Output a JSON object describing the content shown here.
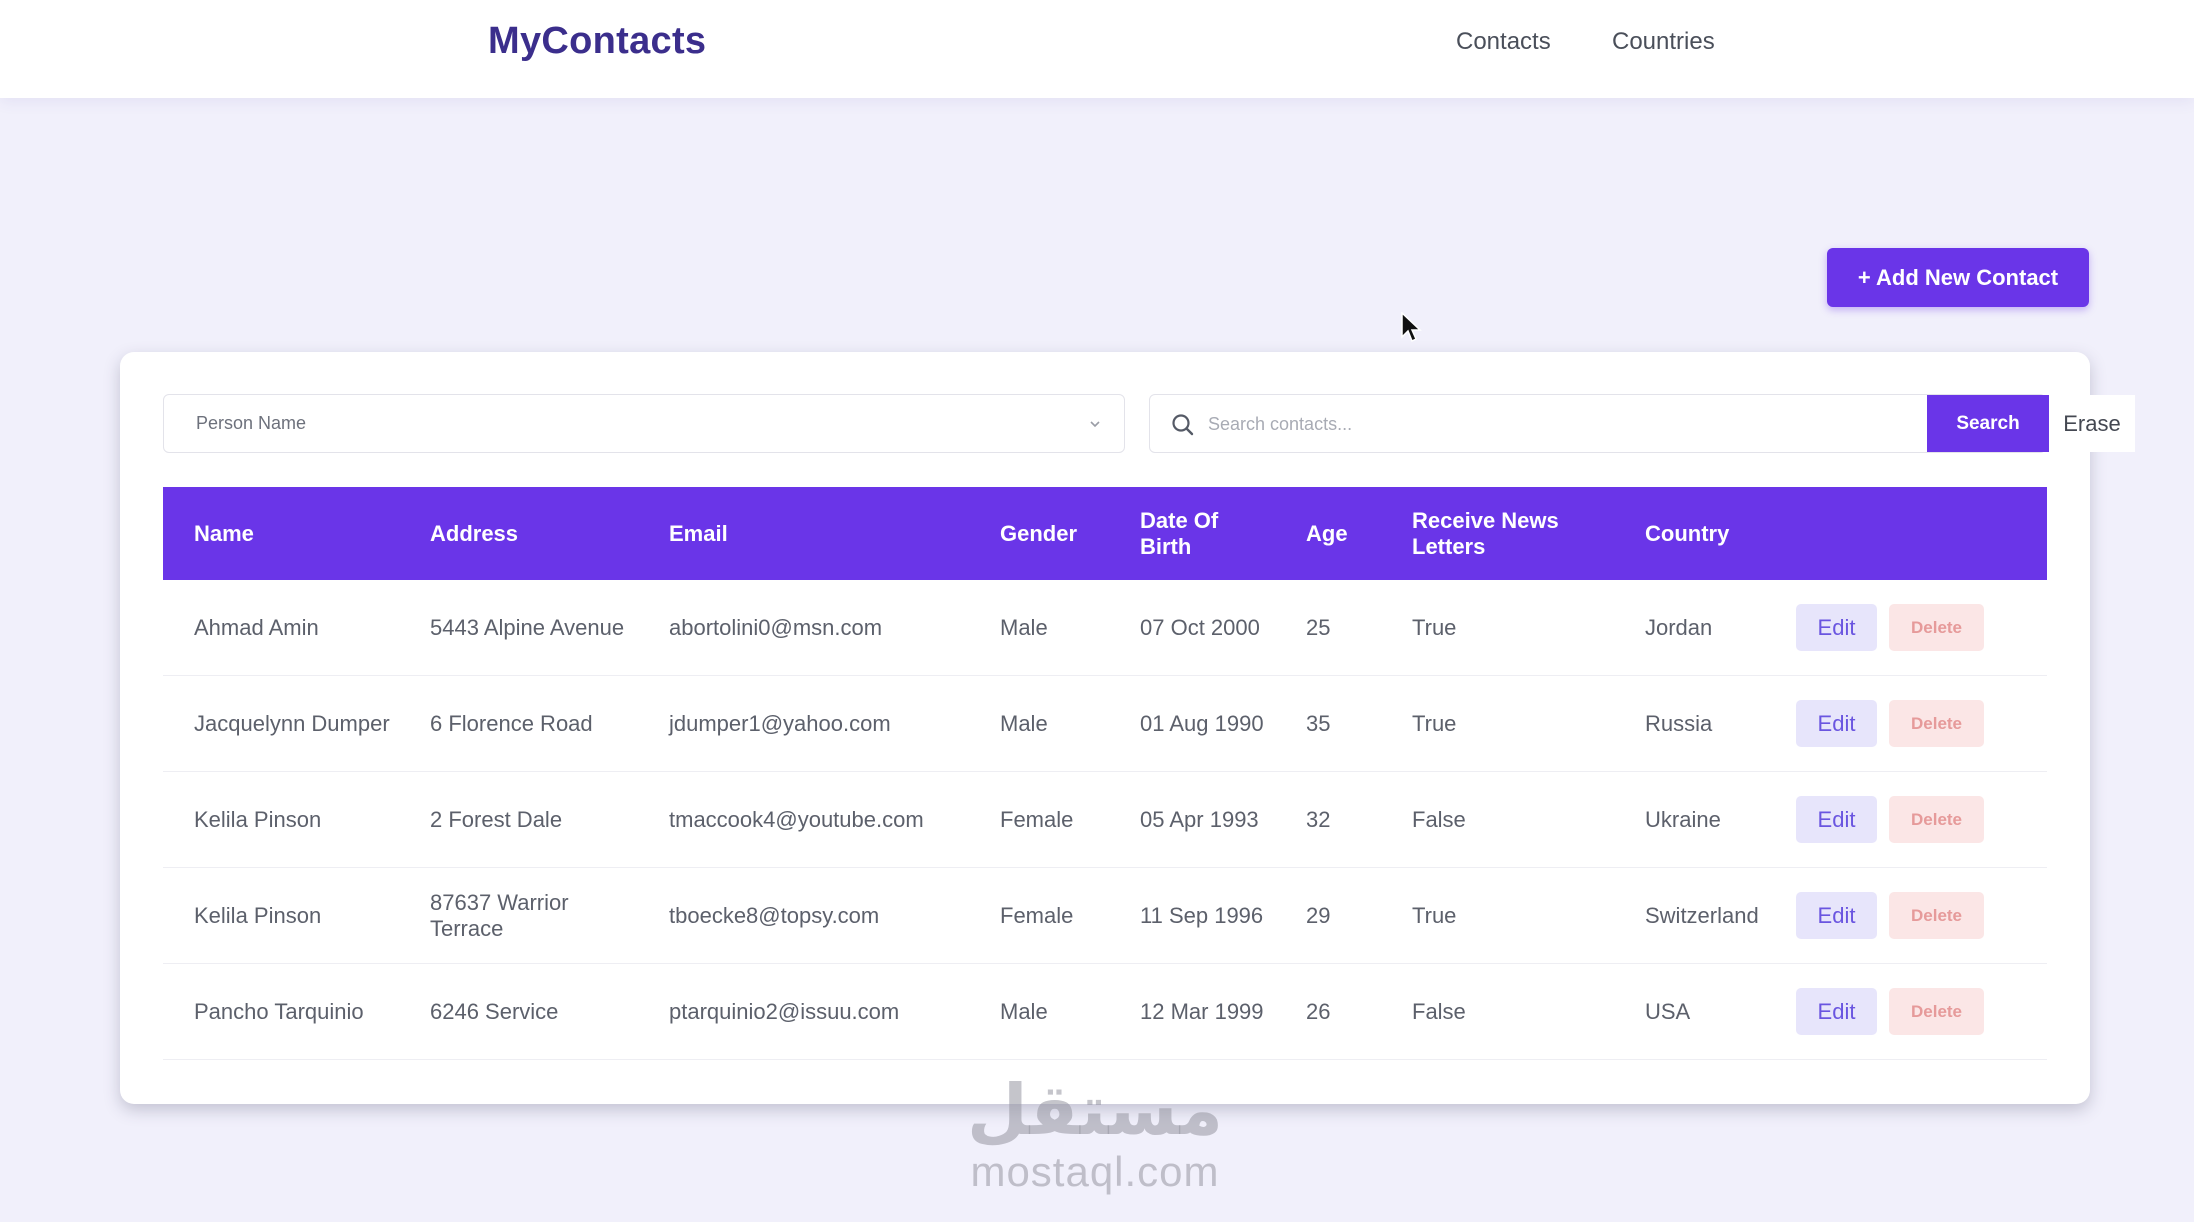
{
  "header": {
    "brand": "MyContacts",
    "nav": [
      {
        "label": "Contacts"
      },
      {
        "label": "Countries"
      }
    ]
  },
  "toolbar": {
    "add_label": "+ Add New Contact"
  },
  "filter": {
    "selected": "Person Name",
    "search_placeholder": "Search contacts...",
    "search_value": "",
    "search_label": "Search",
    "erase_label": "Erase"
  },
  "table": {
    "columns": [
      "Name",
      "Address",
      "Email",
      "Gender",
      "Date Of Birth",
      "Age",
      "Receive News Letters",
      "Country",
      ""
    ],
    "edit_label": "Edit",
    "delete_label": "Delete",
    "rows": [
      {
        "name": "Ahmad Amin",
        "address": "5443 Alpine Avenue",
        "email": "abortolini0@msn.com",
        "gender": "Male",
        "dob": "07 Oct 2000",
        "age": "25",
        "news": "True",
        "country": "Jordan"
      },
      {
        "name": "Jacquelynn Dumper",
        "address": "6 Florence Road",
        "email": "jdumper1@yahoo.com",
        "gender": "Male",
        "dob": "01 Aug 1990",
        "age": "35",
        "news": "True",
        "country": "Russia"
      },
      {
        "name": "Kelila Pinson",
        "address": "2 Forest Dale",
        "email": "tmaccook4@youtube.com",
        "gender": "Female",
        "dob": "05 Apr 1993",
        "age": "32",
        "news": "False",
        "country": "Ukraine"
      },
      {
        "name": "Kelila Pinson",
        "address": "87637 Warrior Terrace",
        "email": "tboecke8@topsy.com",
        "gender": "Female",
        "dob": "11 Sep 1996",
        "age": "29",
        "news": "True",
        "country": "Switzerland"
      },
      {
        "name": "Pancho Tarquinio",
        "address": "6246 Service",
        "email": "ptarquinio2@issuu.com",
        "gender": "Male",
        "dob": "12 Mar 1999",
        "age": "26",
        "news": "False",
        "country": "USA"
      }
    ]
  },
  "watermark": {
    "arabic": "مستقل",
    "latin": "mostaql.com"
  },
  "colors": {
    "accent": "#6a35e8",
    "brand": "#3b2e8c",
    "background": "#f1f0fb"
  }
}
